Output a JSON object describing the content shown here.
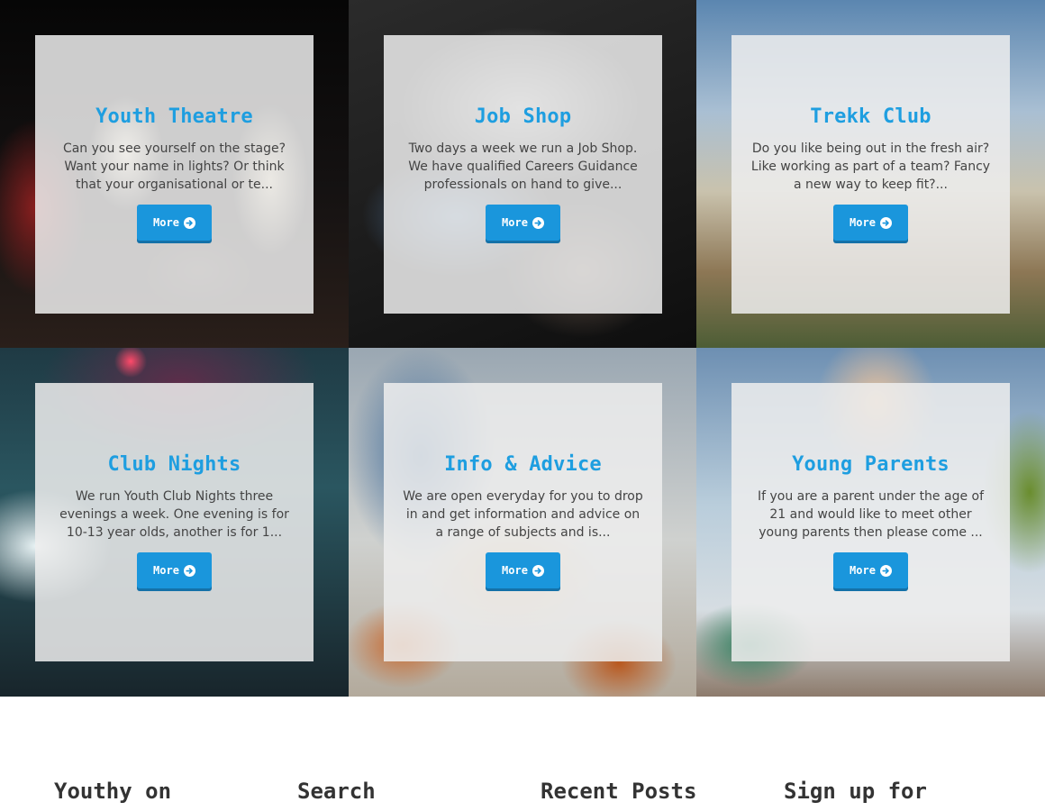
{
  "tiles": [
    {
      "title": "Youth Theatre",
      "text": "Can you see yourself on the stage? Want your name in lights? Or think that your organisational or te...",
      "button": "More"
    },
    {
      "title": "Job Shop",
      "text": "Two days a week we run a Job Shop. We have qualified Careers Guidance professionals on hand to give...",
      "button": "More"
    },
    {
      "title": "Trekk Club",
      "text": "Do you like being out in the fresh air? Like working as part of a team? Fancy a new way to keep fit?...",
      "button": "More"
    },
    {
      "title": "Club Nights",
      "text": "We run Youth Club Nights three evenings a week. One evening is for 10-13 year olds, another is for 1...",
      "button": "More"
    },
    {
      "title": "Info & Advice",
      "text": "We are open everyday for you to drop in and get information and advice on a range of subjects and is...",
      "button": "More"
    },
    {
      "title": "Young Parents",
      "text": "If you are a parent under the age of 21 and would like to meet other young parents then please come ...",
      "button": "More"
    }
  ],
  "footer": {
    "headings": [
      "Youthy on",
      "Search",
      "Recent Posts",
      "Sign up for"
    ]
  },
  "colors": {
    "accent": "#1e9ee0",
    "button": "#1a96dc",
    "button_shadow": "#1471a8",
    "card_text": "#444444",
    "heading": "#333333"
  },
  "icons": {
    "more_button": "arrow-circle-right-icon"
  }
}
